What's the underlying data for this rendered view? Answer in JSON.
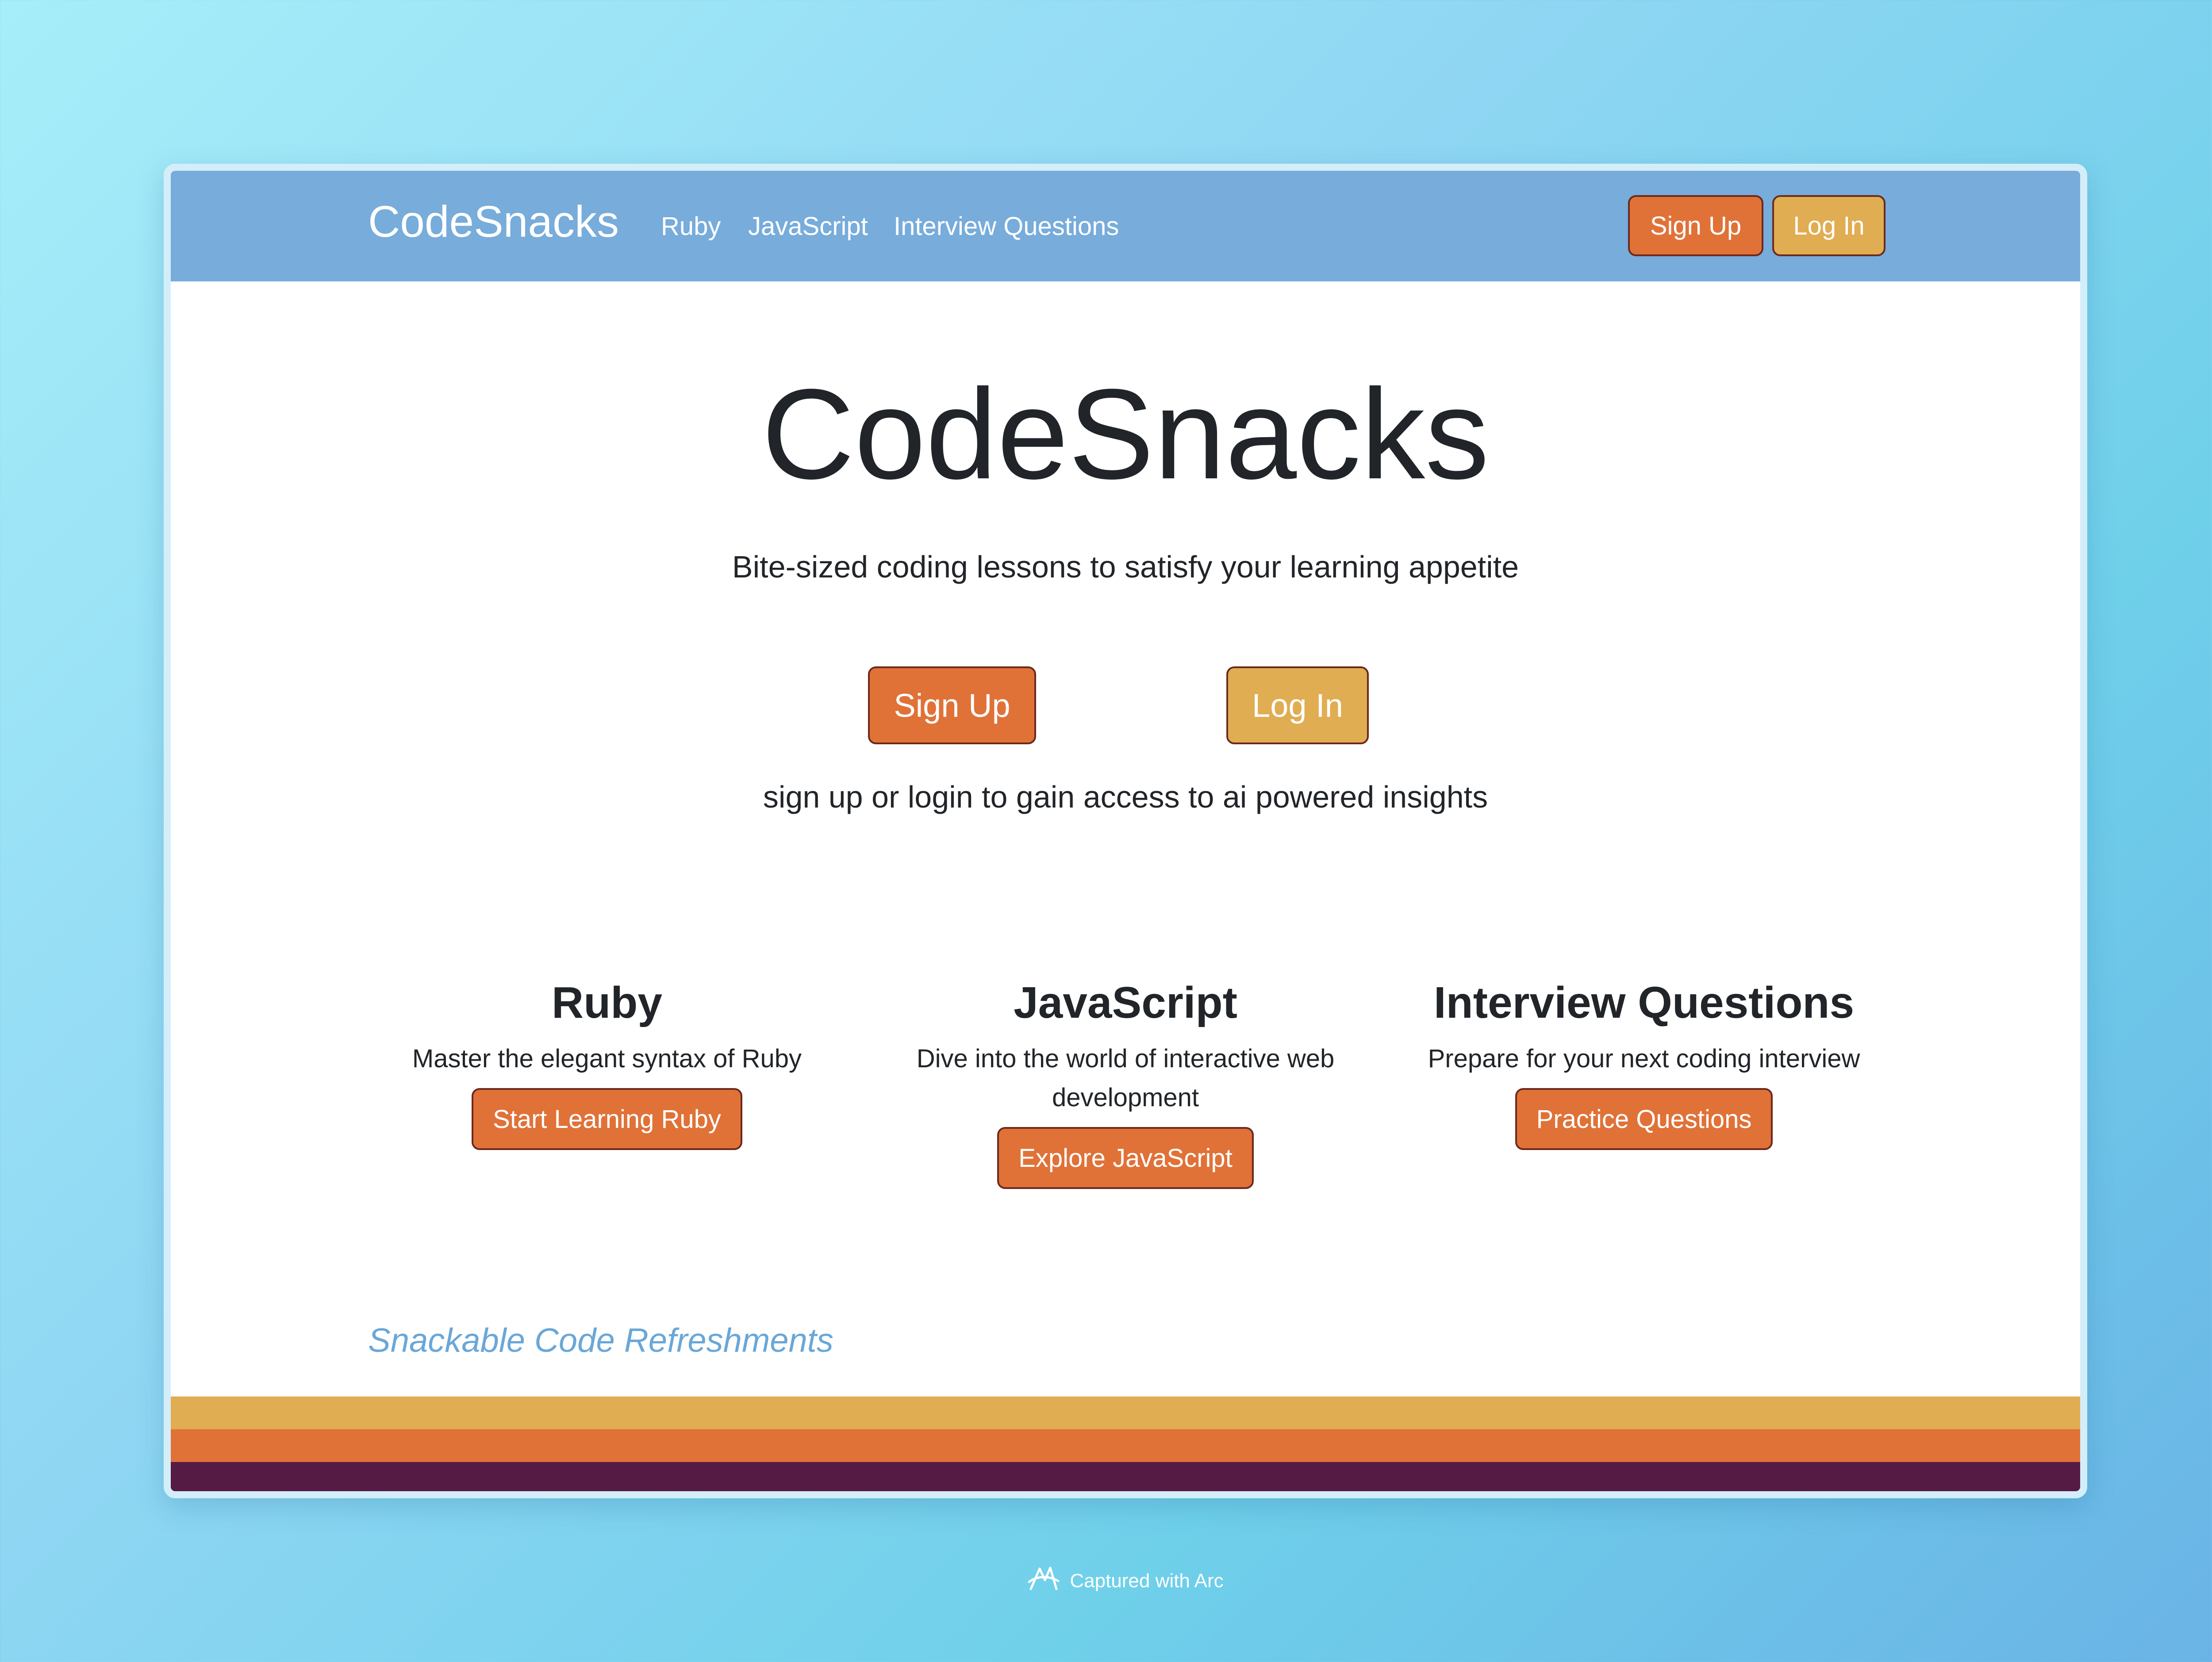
{
  "navbar": {
    "brand": "CodeSnacks",
    "links": [
      "Ruby",
      "JavaScript",
      "Interview Questions"
    ],
    "signup_label": "Sign Up",
    "login_label": "Log In"
  },
  "hero": {
    "title": "CodeSnacks",
    "subtitle": "Bite-sized coding lessons to satisfy your learning appetite",
    "signup_label": "Sign Up",
    "login_label": "Log In",
    "note": "sign up or login to gain access to ai powered insights"
  },
  "features": [
    {
      "title": "Ruby",
      "description": "Master the elegant syntax of Ruby",
      "button": "Start Learning Ruby"
    },
    {
      "title": "JavaScript",
      "description": "Dive into the world of interactive web development",
      "button": "Explore JavaScript"
    },
    {
      "title": "Interview Questions",
      "description": "Prepare for your next coding interview",
      "button": "Practice Questions"
    }
  ],
  "footer": {
    "tagline": "Snackable Code Refreshments",
    "stripe_colors": [
      "#e0ad52",
      "#e07238",
      "#551b45"
    ]
  },
  "capture_note": {
    "icon": "arc-logo-icon",
    "text": "Captured with Arc"
  },
  "colors": {
    "navbar": "#77acdb",
    "primary_button": "#e07238",
    "secondary_button": "#e0ad52",
    "tagline": "#6aa7d8"
  }
}
